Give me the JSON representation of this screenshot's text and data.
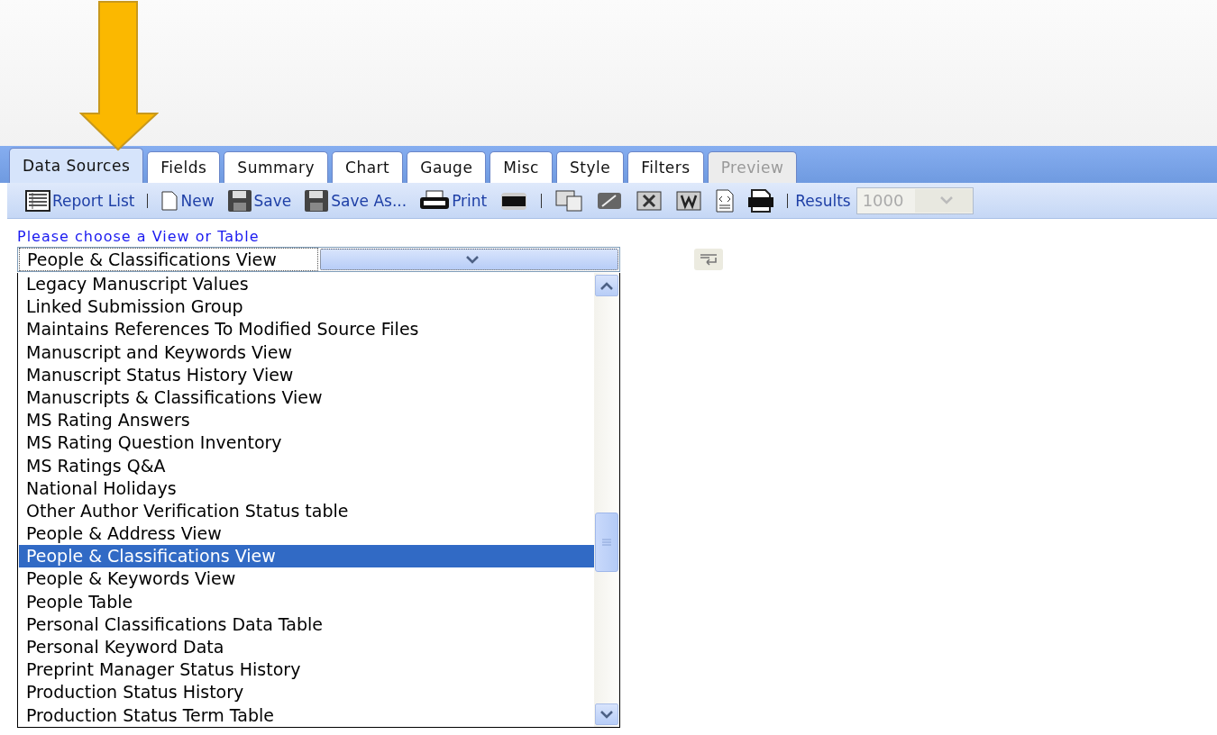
{
  "tabs": [
    {
      "label": "Data Sources",
      "selected": true,
      "disabled": false
    },
    {
      "label": "Fields",
      "selected": false,
      "disabled": false
    },
    {
      "label": "Summary",
      "selected": false,
      "disabled": false
    },
    {
      "label": "Chart",
      "selected": false,
      "disabled": false
    },
    {
      "label": "Gauge",
      "selected": false,
      "disabled": false
    },
    {
      "label": "Misc",
      "selected": false,
      "disabled": false
    },
    {
      "label": "Style",
      "selected": false,
      "disabled": false
    },
    {
      "label": "Filters",
      "selected": false,
      "disabled": false
    },
    {
      "label": "Preview",
      "selected": false,
      "disabled": true
    }
  ],
  "toolbar": [
    {
      "kind": "list",
      "label": "Report List"
    },
    {
      "kind": "sep"
    },
    {
      "kind": "new",
      "label": "New"
    },
    {
      "kind": "save",
      "label": "Save"
    },
    {
      "kind": "save",
      "label": "Save As..."
    },
    {
      "kind": "pdf",
      "label": "Print"
    },
    {
      "kind": "sql"
    },
    {
      "kind": "sep"
    },
    {
      "kind": "csv"
    },
    {
      "kind": "edit"
    },
    {
      "kind": "excel"
    },
    {
      "kind": "word"
    },
    {
      "kind": "xml"
    },
    {
      "kind": "rtf"
    },
    {
      "kind": "sep"
    }
  ],
  "results": {
    "label": "Results",
    "value": "1000",
    "disabled": true
  },
  "prompt": "Please choose a View or Table",
  "select": {
    "value": "People & Classifications View"
  },
  "options": [
    {
      "label": "Legacy Manuscript Values",
      "selected": false
    },
    {
      "label": "Linked Submission Group",
      "selected": false
    },
    {
      "label": "Maintains References To Modified Source Files",
      "selected": false
    },
    {
      "label": "Manuscript and Keywords View",
      "selected": false
    },
    {
      "label": "Manuscript Status History View",
      "selected": false
    },
    {
      "label": "Manuscripts & Classifications View",
      "selected": false
    },
    {
      "label": "MS Rating Answers",
      "selected": false
    },
    {
      "label": "MS Rating Question Inventory",
      "selected": false
    },
    {
      "label": "MS Ratings Q&A",
      "selected": false
    },
    {
      "label": "National Holidays",
      "selected": false
    },
    {
      "label": "Other Author Verification Status table",
      "selected": false
    },
    {
      "label": "People & Address View",
      "selected": false
    },
    {
      "label": "People & Classifications View",
      "selected": true
    },
    {
      "label": "People & Keywords View",
      "selected": false
    },
    {
      "label": "People Table",
      "selected": false
    },
    {
      "label": "Personal Classifications Data Table",
      "selected": false
    },
    {
      "label": "Personal Keyword Data",
      "selected": false
    },
    {
      "label": "Preprint Manager Status History",
      "selected": false
    },
    {
      "label": "Production Status History",
      "selected": false
    },
    {
      "label": "Production Status Term Table",
      "selected": false
    }
  ]
}
